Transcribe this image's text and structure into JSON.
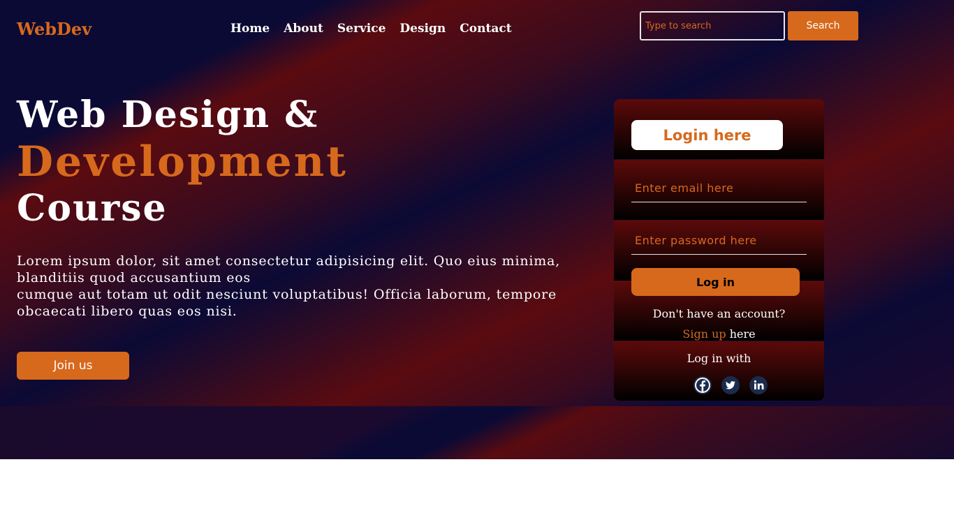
{
  "header": {
    "logo": "WebDev",
    "nav": [
      "Home",
      "About",
      "Service",
      "Design",
      "Contact"
    ],
    "search_placeholder": "Type to search",
    "search_button": "Search"
  },
  "hero": {
    "title_line1": "Web Design &",
    "title_line2": "Development",
    "title_line3": "Course",
    "paragraph_line1": "Lorem ipsum dolor, sit amet consectetur adipisicing elit. Quo eius minima, blanditiis quod accusantium eos",
    "paragraph_line2": "cumque aut totam ut odit nesciunt voluptatibus! Officia laborum, tempore obcaecati libero quas eos nisi.",
    "join_button": "Join us"
  },
  "login": {
    "title": "Login here",
    "email_placeholder": "Enter email here",
    "password_placeholder": "Enter password here",
    "login_button": "Log in",
    "no_account": "Don't have an account?",
    "signup_link": "Sign up",
    "signup_suffix": "here",
    "login_with": "Log in with",
    "social_icons": [
      "facebook-icon",
      "twitter-icon",
      "linkedin-icon"
    ]
  },
  "colors": {
    "accent": "#d7691d",
    "navy": "#0b0a35",
    "maroon": "#5a0b10"
  }
}
